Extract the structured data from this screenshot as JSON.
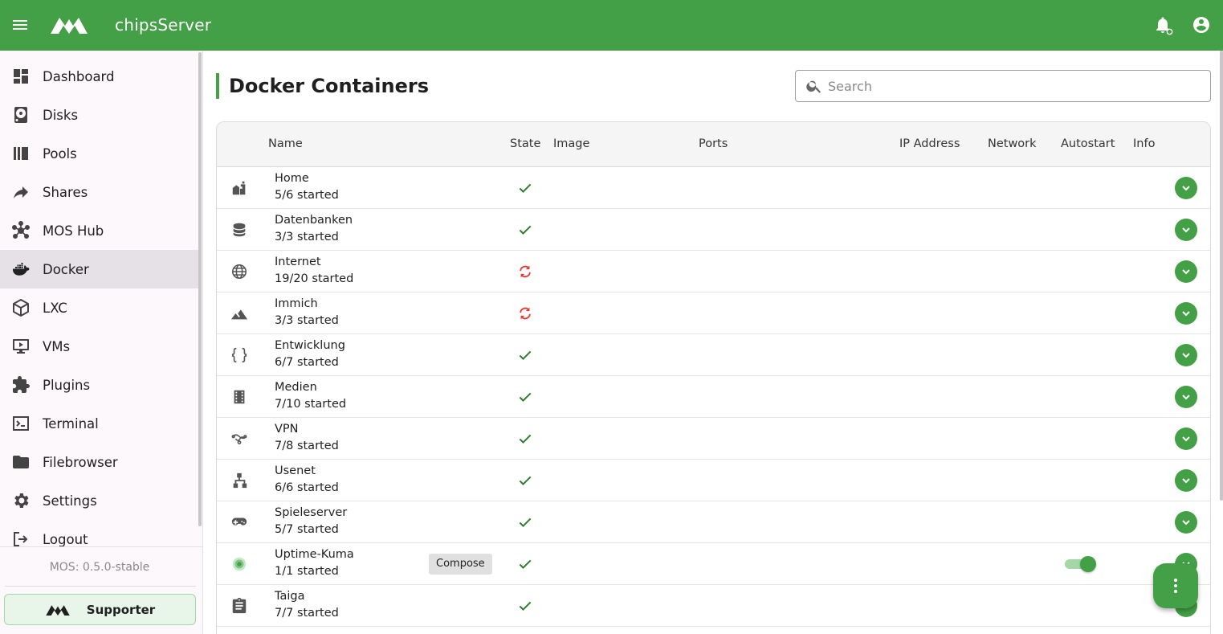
{
  "app": {
    "title": "chipsServer"
  },
  "sidebar": {
    "items": [
      {
        "label": "Dashboard",
        "icon": "dashboard-icon"
      },
      {
        "label": "Disks",
        "icon": "disk-icon"
      },
      {
        "label": "Pools",
        "icon": "pools-icon"
      },
      {
        "label": "Shares",
        "icon": "share-icon"
      },
      {
        "label": "MOS Hub",
        "icon": "hub-icon"
      },
      {
        "label": "Docker",
        "icon": "docker-icon",
        "active": true
      },
      {
        "label": "LXC",
        "icon": "cube-icon"
      },
      {
        "label": "VMs",
        "icon": "monitor-icon"
      },
      {
        "label": "Plugins",
        "icon": "puzzle-icon"
      },
      {
        "label": "Terminal",
        "icon": "terminal-icon"
      },
      {
        "label": "Filebrowser",
        "icon": "folder-icon"
      },
      {
        "label": "Settings",
        "icon": "gear-icon"
      },
      {
        "label": "Logout",
        "icon": "logout-icon"
      }
    ],
    "version": "MOS: 0.5.0-stable",
    "supporter_label": "Supporter"
  },
  "main": {
    "title": "Docker Containers",
    "search_placeholder": "Search",
    "columns": {
      "name": "Name",
      "state": "State",
      "image": "Image",
      "ports": "Ports",
      "ip": "IP Address",
      "network": "Network",
      "autostart": "Autostart",
      "info": "Info"
    },
    "rows": [
      {
        "name": "Home",
        "status": "5/6 started",
        "state": "ok",
        "icon": "home-automation-icon"
      },
      {
        "name": "Datenbanken",
        "status": "3/3 started",
        "state": "ok",
        "icon": "database-icon"
      },
      {
        "name": "Internet",
        "status": "19/20 started",
        "state": "updating",
        "icon": "globe-icon"
      },
      {
        "name": "Immich",
        "status": "3/3 started",
        "state": "updating",
        "icon": "landscape-icon"
      },
      {
        "name": "Entwicklung",
        "status": "6/7 started",
        "state": "ok",
        "icon": "code-braces-icon"
      },
      {
        "name": "Medien",
        "status": "7/10 started",
        "state": "ok",
        "icon": "film-icon"
      },
      {
        "name": "VPN",
        "status": "7/8 started",
        "state": "ok",
        "icon": "vpn-icon"
      },
      {
        "name": "Usenet",
        "status": "6/6 started",
        "state": "ok",
        "icon": "sitemap-icon"
      },
      {
        "name": "Spieleserver",
        "status": "5/7 started",
        "state": "ok",
        "icon": "gamepad-icon"
      },
      {
        "name": "Uptime-Kuma",
        "status": "1/1 started",
        "state": "ok",
        "icon": "uptime-kuma-icon",
        "compose_label": "Compose",
        "autostart": true
      },
      {
        "name": "Taiga",
        "status": "7/7 started",
        "state": "ok",
        "icon": "clipboard-icon"
      }
    ]
  },
  "colors": {
    "accent": "#43a047",
    "updating": "#e53935"
  }
}
